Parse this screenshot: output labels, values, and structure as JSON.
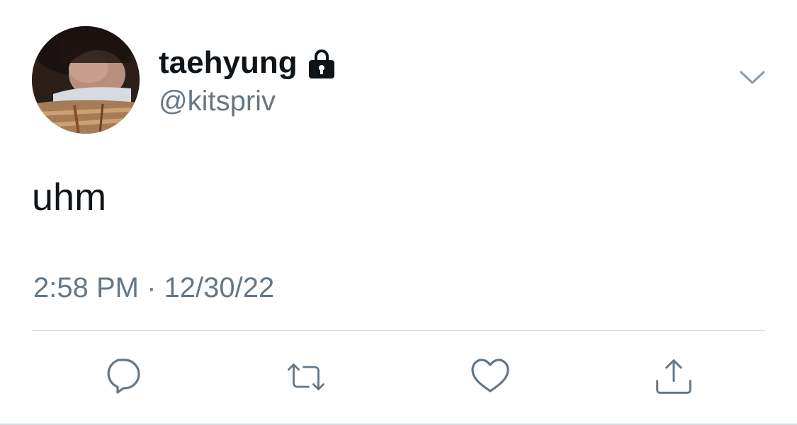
{
  "tweet": {
    "author": {
      "display_name": "taehyung",
      "handle": "@kitspriv",
      "avatar": "avatar-photo",
      "protected_icon": "lock-icon"
    },
    "menu_icon": "chevron-down-icon",
    "text": "uhm",
    "timestamp": "2:58 PM · 12/30/22",
    "actions": [
      {
        "name": "reply",
        "icon": "reply-icon"
      },
      {
        "name": "retweet",
        "icon": "retweet-icon"
      },
      {
        "name": "like",
        "icon": "heart-icon"
      },
      {
        "name": "share",
        "icon": "share-icon"
      }
    ]
  },
  "colors": {
    "primary_text": "#0f1419",
    "secondary_text": "#657786",
    "divider": "#d5dce2",
    "icon": "#657786"
  }
}
